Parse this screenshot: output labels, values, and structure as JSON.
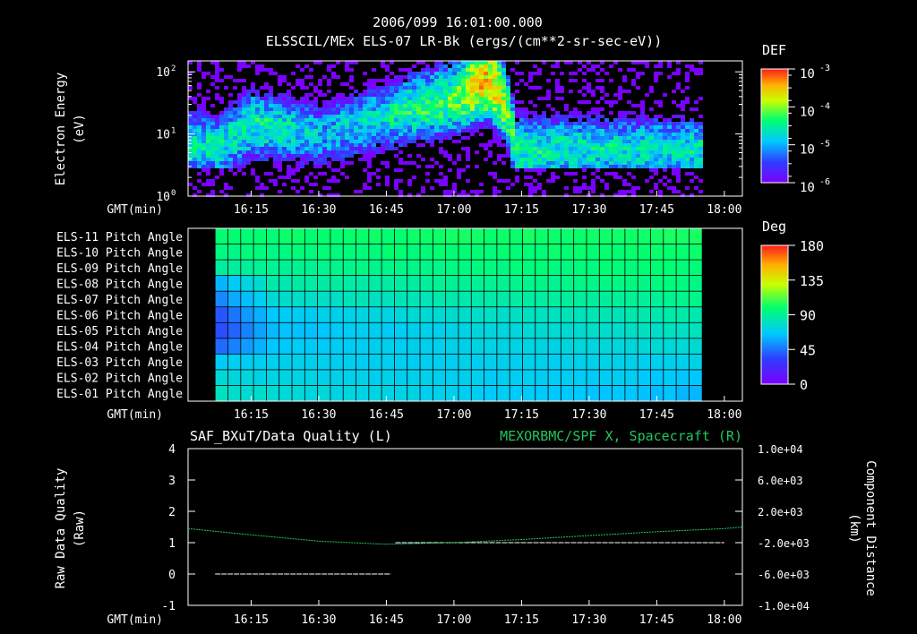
{
  "header": {
    "title_line1": "2006/099 16:01:00.000",
    "title_line2": "ELSSCIL/MEx ELS-07 LR-Bk  (ergs/(cm**2-sr-sec-eV))"
  },
  "chart_data": [
    {
      "type": "heatmap",
      "panel": "energy-spectrogram",
      "ylabel": [
        "Electron Energy",
        "(eV)"
      ],
      "xlabel": "GMT(min)",
      "x_ticks": [
        "16:15",
        "16:30",
        "16:45",
        "17:00",
        "17:15",
        "17:30",
        "17:45",
        "18:00"
      ],
      "x_tick_minutes": [
        975,
        990,
        1005,
        1020,
        1035,
        1050,
        1065,
        1080
      ],
      "x_range_minutes": [
        961,
        1084
      ],
      "y_scale": "log",
      "y_range": [
        1,
        150
      ],
      "y_ticks": [
        {
          "value": 1,
          "label": "10",
          "exp": "0"
        },
        {
          "value": 10,
          "label": "10",
          "exp": "1"
        },
        {
          "value": 100,
          "label": "10",
          "exp": "2"
        }
      ],
      "data_end_minutes": 1075,
      "colorbar": {
        "title": "DEF",
        "scale": "log",
        "range": [
          1e-06,
          0.001
        ],
        "ticks": [
          {
            "value": 0.001,
            "label": "10",
            "exp": "-3"
          },
          {
            "value": 0.0001,
            "label": "10",
            "exp": "-4"
          },
          {
            "value": 1e-05,
            "label": "10",
            "exp": "-5"
          },
          {
            "value": 1e-06,
            "label": "10",
            "exp": "-6"
          }
        ]
      },
      "features": [
        {
          "minute": 968,
          "peak_energy_ev": 7,
          "peak_def": 2e-05
        },
        {
          "minute": 975,
          "peak_energy_ev": 15,
          "peak_def": 3e-05
        },
        {
          "minute": 990,
          "peak_energy_ev": 10,
          "peak_def": 1e-05
        },
        {
          "minute": 1005,
          "peak_energy_ev": 20,
          "peak_def": 2e-05
        },
        {
          "minute": 1020,
          "peak_energy_ev": 40,
          "peak_def": 6e-05
        },
        {
          "minute": 1027,
          "peak_energy_ev": 80,
          "peak_def": 0.0003
        },
        {
          "minute": 1033,
          "peak_energy_ev": 6,
          "peak_def": 3e-05
        },
        {
          "minute": 1050,
          "peak_energy_ev": 6,
          "peak_def": 2e-05
        },
        {
          "minute": 1075,
          "peak_energy_ev": 6,
          "peak_def": 2e-05
        }
      ]
    },
    {
      "type": "heatmap",
      "panel": "pitch-angle",
      "xlabel": "GMT(min)",
      "x_ticks": [
        "16:15",
        "16:30",
        "16:45",
        "17:00",
        "17:15",
        "17:30",
        "17:45",
        "18:00"
      ],
      "x_tick_minutes": [
        975,
        990,
        1005,
        1020,
        1035,
        1050,
        1065,
        1080
      ],
      "x_range_minutes": [
        961,
        1084
      ],
      "data_start_minutes": 967,
      "data_end_minutes": 1075,
      "rows": [
        "ELS-11 Pitch Angle",
        "ELS-10 Pitch Angle",
        "ELS-09 Pitch Angle",
        "ELS-08 Pitch Angle",
        "ELS-07 Pitch Angle",
        "ELS-06 Pitch Angle",
        "ELS-05 Pitch Angle",
        "ELS-04 Pitch Angle",
        "ELS-03 Pitch Angle",
        "ELS-02 Pitch Angle",
        "ELS-01 Pitch Angle"
      ],
      "row_pitch_start_deg": [
        98,
        94,
        88,
        80,
        70,
        58,
        55,
        62,
        68,
        74,
        80
      ],
      "row_pitch_end_deg": [
        102,
        100,
        98,
        95,
        92,
        86,
        80,
        75,
        70,
        66,
        62
      ],
      "colorbar": {
        "title": "Deg",
        "range": [
          0,
          180
        ],
        "ticks": [
          180,
          135,
          90,
          45,
          0
        ]
      }
    },
    {
      "type": "line",
      "panel": "data-quality",
      "left_title": "SAF_BXuT/Data Quality (L)",
      "right_title": "MEXORBMC/SPF X, Spacecraft (R)",
      "left_ylabel": [
        "Raw Data Quality",
        "(Raw)"
      ],
      "right_ylabel": [
        "Component Distance",
        "(km)"
      ],
      "xlabel": "GMT(min)",
      "x_ticks": [
        "16:15",
        "16:30",
        "16:45",
        "17:00",
        "17:15",
        "17:30",
        "17:45",
        "18:00"
      ],
      "x_tick_minutes": [
        975,
        990,
        1005,
        1020,
        1035,
        1050,
        1065,
        1080
      ],
      "x_range_minutes": [
        961,
        1084
      ],
      "left_ylim": [
        -1,
        4
      ],
      "left_ticks": [
        4,
        3,
        2,
        1,
        0,
        -1
      ],
      "right_ylim": [
        -10000,
        10000
      ],
      "right_ticks": [
        "1.0e+04",
        "6.0e+03",
        "2.0e+03",
        "-2.0e+03",
        "-6.0e+03",
        "-1.0e+04"
      ],
      "right_tick_values": [
        10000,
        6000,
        2000,
        -2000,
        -6000,
        -10000
      ],
      "series": [
        {
          "axis": "left",
          "color": "#ffffff",
          "segments": [
            {
              "x": [
                967,
                1006
              ],
              "y": [
                0,
                0
              ]
            },
            {
              "x": [
                1007,
                1080
              ],
              "y": [
                1,
                1
              ]
            }
          ]
        },
        {
          "axis": "right",
          "color": "#22c55e",
          "x": [
            961,
            975,
            990,
            1005,
            1020,
            1035,
            1050,
            1065,
            1080,
            1084
          ],
          "y": [
            -200,
            -1000,
            -1800,
            -2200,
            -2000,
            -1600,
            -1100,
            -600,
            -200,
            0
          ]
        }
      ]
    }
  ]
}
